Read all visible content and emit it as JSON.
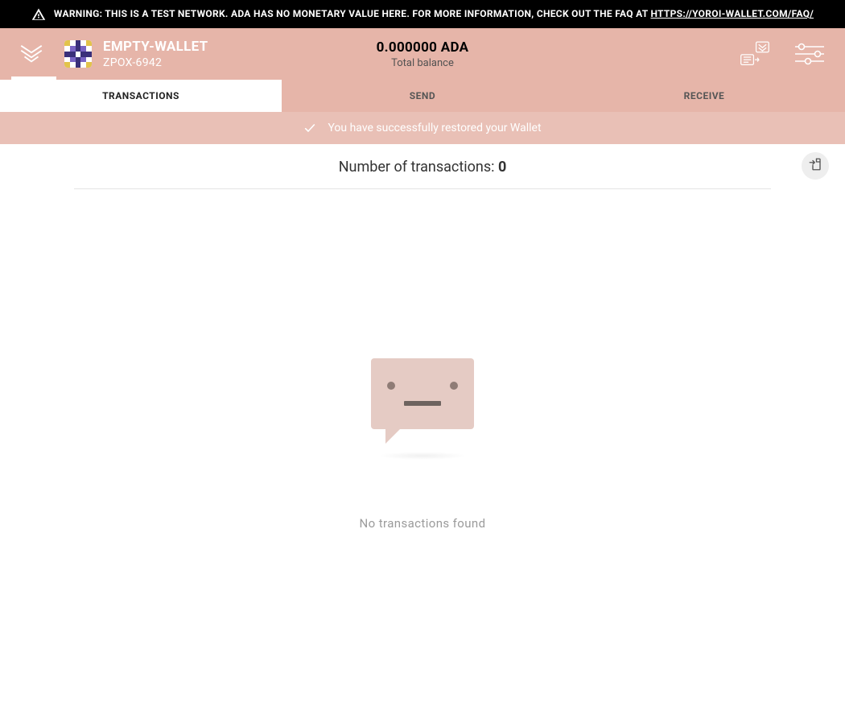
{
  "warning": {
    "text_prefix": "WARNING: THIS IS A TEST NETWORK. ADA HAS NO MONETARY VALUE HERE. FOR MORE INFORMATION, CHECK OUT THE FAQ AT ",
    "link_text": "HTTPS://YOROI-WALLET.COM/FAQ/"
  },
  "header": {
    "wallet_name": "EMPTY-WALLET",
    "wallet_id": "ZPOX-6942",
    "balance_amount": "0.000000",
    "balance_currency": "ADA",
    "balance_label": "Total balance"
  },
  "tabs": {
    "transactions": "TRANSACTIONS",
    "send": "SEND",
    "receive": "RECEIVE",
    "active": "transactions"
  },
  "success": {
    "message": "You have successfully restored your Wallet"
  },
  "transactions": {
    "count_label": "Number of transactions: ",
    "count": "0",
    "empty_message": "No transactions found"
  },
  "colors": {
    "accent": "#e6b5a9",
    "accent_light": "#e9c0b6"
  },
  "identicon": {
    "pattern": [
      "#e2c34a",
      "#ffffff",
      "#3a2f7a",
      "#ffffff",
      "#e2c34a",
      "#ffffff",
      "#7a64c4",
      "#3a2f7a",
      "#7a64c4",
      "#ffffff",
      "#3a2f7a",
      "#3a2f7a",
      "#ffffff",
      "#3a2f7a",
      "#3a2f7a",
      "#ffffff",
      "#7a64c4",
      "#3a2f7a",
      "#7a64c4",
      "#ffffff",
      "#e2c34a",
      "#ffffff",
      "#3a2f7a",
      "#ffffff",
      "#e2c34a"
    ]
  }
}
